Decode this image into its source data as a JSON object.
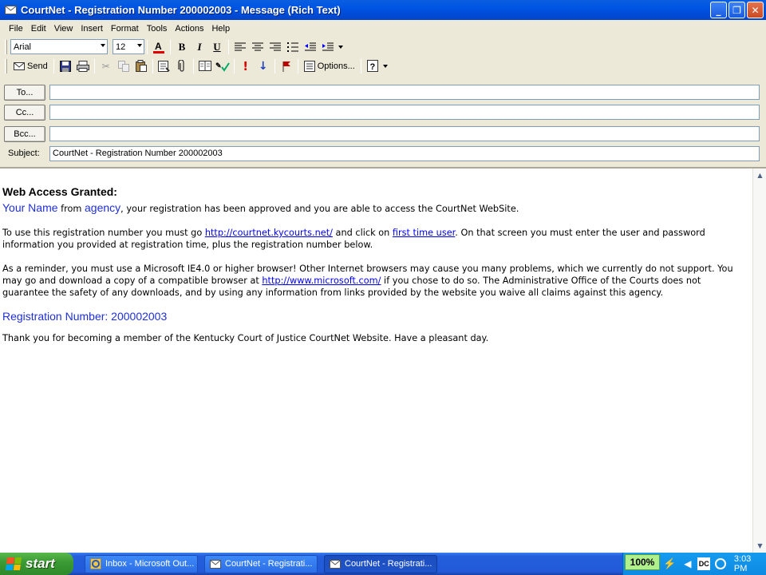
{
  "window": {
    "title": "CourtNet - Registration Number 200002003   - Message (Rich Text)",
    "minimize": "_",
    "maximize": "❐",
    "close": "✕"
  },
  "menu": [
    "File",
    "Edit",
    "View",
    "Insert",
    "Format",
    "Tools",
    "Actions",
    "Help"
  ],
  "format_toolbar": {
    "font": "Arial",
    "size": "12",
    "bold": "B",
    "italic": "I",
    "underline": "U"
  },
  "standard_toolbar": {
    "send": "Send",
    "options": "Options..."
  },
  "header": {
    "to_label": "To...",
    "cc_label": "Cc...",
    "bcc_label": "Bcc...",
    "subject_label": "Subject:",
    "to_value": "",
    "cc_value": "",
    "bcc_value": "",
    "subject_value": "CourtNet - Registration Number 200002003"
  },
  "message": {
    "heading": "Web Access Granted:",
    "your_name": "Your Name",
    "from_word": " from ",
    "agency": "agency",
    "approved_text": ", your registration has been approved and you are able to access the CourtNet WebSite.",
    "p2_a": "To use this registration number you must go ",
    "p2_link1": "http://courtnet.kycourts.net/",
    "p2_b": " and click on ",
    "p2_link2": "first time user",
    "p2_c": ". On that screen you must enter the user and password information you provided at registration time, plus the registration number below.",
    "p3_a": "As a reminder, you must use a Microsoft IE4.0 or higher browser! Other Internet browsers may cause you many problems, which we currently do not support. You may go and download a copy of a compatible browser at ",
    "p3_link": "http://www.microsoft.com/",
    "p3_b": " if you chose to do so. The Administrative Office of the Courts does not guarantee the safety of any downloads, and by using any information from links provided by the website you waive all claims against this agency.",
    "reg_label": "Registration Number: ",
    "reg_number": "200002003",
    "closing": "Thank you for becoming a member of the Kentucky Court of Justice CourtNet Website. Have a pleasant day."
  },
  "taskbar": {
    "start": "start",
    "tasks": [
      "Inbox - Microsoft Out...",
      "CourtNet - Registrati...",
      "CourtNet - Registrati..."
    ],
    "zoom": "100%",
    "clock": "3:03 PM"
  }
}
